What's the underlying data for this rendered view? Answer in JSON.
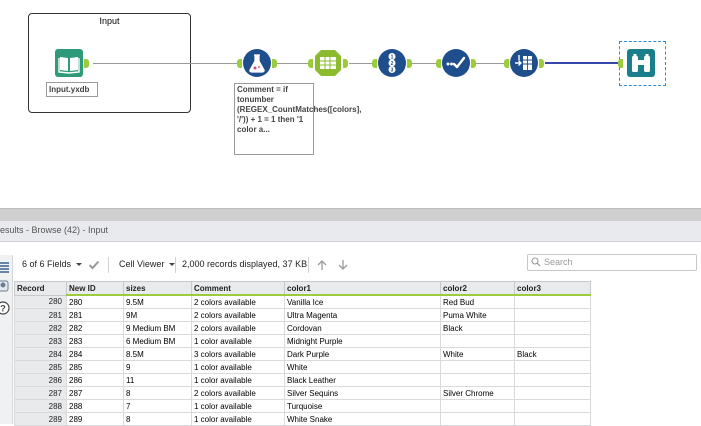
{
  "canvas": {
    "container": {
      "title": "Input"
    },
    "input_label": "Input.yxdb",
    "annotation": "Comment = if tonumber (REGEX_CountMatches([colors], '/')) + 1 = 1 then '1 color a...",
    "colors": {
      "tool_green": "#2e9a7a",
      "tool_blue": "#1f4e8c",
      "tool_teal": "#1b7e8c",
      "anchor": "#9ccb3b",
      "selected_connector": "#3549a8"
    },
    "tools": [
      {
        "name": "input-data-tool",
        "icon": "book-icon"
      },
      {
        "name": "formula-tool",
        "icon": "flask-icon"
      },
      {
        "name": "text-to-columns-tool",
        "icon": "columns-icon"
      },
      {
        "name": "record-id-tool",
        "icon": "numbered-circles-icon"
      },
      {
        "name": "select-tool",
        "icon": "checkmark-icon"
      },
      {
        "name": "transpose-tool",
        "icon": "table-arrows-icon"
      },
      {
        "name": "browse-tool",
        "icon": "binoculars-icon"
      }
    ]
  },
  "results": {
    "title": "esults - Browse (42) - Input",
    "fields_label": "6 of 6 Fields",
    "viewer_label": "Cell Viewer",
    "records_info": "2,000 records displayed, 37 KB",
    "search_placeholder": "Search",
    "columns": [
      "Record",
      "New ID",
      "sizes",
      "Comment",
      "color1",
      "color2",
      "color3"
    ],
    "rows": [
      [
        "280",
        "280",
        "9.5M",
        "2 colors available",
        "Vanilla Ice",
        "Red Bud",
        ""
      ],
      [
        "281",
        "281",
        "9M",
        "2 colors available",
        "Ultra Magenta",
        "Puma White",
        ""
      ],
      [
        "282",
        "282",
        "9 Medium BM",
        "2 colors available",
        "Cordovan",
        "Black",
        ""
      ],
      [
        "283",
        "283",
        "6 Medium BM",
        "1 color available",
        "Midnight Purple",
        "",
        ""
      ],
      [
        "284",
        "284",
        "8.5M",
        "3 colors available",
        "Dark Purple",
        "White",
        "Black"
      ],
      [
        "285",
        "285",
        "9",
        "1 color available",
        "White",
        "",
        ""
      ],
      [
        "286",
        "286",
        "11",
        "1 color available",
        "Black Leather",
        "",
        ""
      ],
      [
        "287",
        "287",
        "8",
        "2 colors available",
        "Silver Sequins",
        "Silver Chrome",
        ""
      ],
      [
        "288",
        "288",
        "7",
        "1 color available",
        "Turquoise",
        "",
        ""
      ],
      [
        "289",
        "289",
        "8",
        "1 color available",
        "White Snake",
        "",
        ""
      ]
    ]
  }
}
